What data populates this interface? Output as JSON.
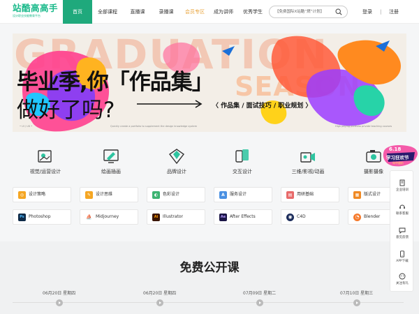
{
  "header": {
    "logo_title": "站酷高高手",
    "logo_subtitle": "设计职业技能教育平台",
    "nav": [
      {
        "label": "首页",
        "active": true
      },
      {
        "label": "全部课程"
      },
      {
        "label": "直播课"
      },
      {
        "label": "录播课"
      },
      {
        "label": "会员专区",
        "vip": true
      },
      {
        "label": "成为讲师"
      },
      {
        "label": "优秀学生"
      }
    ],
    "search_value": "【免费国际X站酷“燃”计划】",
    "login_label": "登录",
    "separator": "|",
    "register_label": "注册",
    "accent_color": "#1fa97c"
  },
  "banner": {
    "bg_word_1": "GRADUATION",
    "bg_word_2": "SEASON",
    "headline_1": "毕业季,你「作品集」",
    "headline_2": "做好了吗?",
    "tagline": "〈 作品集 / 面试技巧 / 职业规划 〉",
    "tiny_left": "• UI / UX •",
    "tiny_mid": "Quickly create a portfolio to supplement the design knowledge system",
    "tiny_right": "High paying portfolio private teaching courses"
  },
  "categories": [
    {
      "label": "视觉/运营设计",
      "icon": "visual-design-icon"
    },
    {
      "label": "绘画插画",
      "icon": "illustration-icon"
    },
    {
      "label": "品牌设计",
      "icon": "brand-design-icon"
    },
    {
      "label": "交互设计",
      "icon": "interaction-design-icon"
    },
    {
      "label": "三维/影视/动画",
      "icon": "3d-animation-icon"
    },
    {
      "label": "摄影摄像",
      "icon": "camera-icon"
    }
  ],
  "tags_row1": [
    {
      "label": "设计策略",
      "icon": "strategy-icon",
      "color": "#f5a623",
      "glyph": "◎"
    },
    {
      "label": "设计思维",
      "icon": "thinking-icon",
      "color": "#f5a623",
      "glyph": "✎"
    },
    {
      "label": "色彩设计",
      "icon": "color-icon",
      "color": "#3cb371",
      "glyph": "◐"
    },
    {
      "label": "服务设计",
      "icon": "service-icon",
      "color": "#4a90e2",
      "glyph": "A"
    },
    {
      "label": "用研基础",
      "icon": "research-icon",
      "color": "#e86a6a",
      "glyph": "▤"
    },
    {
      "label": "版式设计",
      "icon": "layout-icon",
      "color": "#f08a24",
      "glyph": "▦"
    }
  ],
  "tags_row2": [
    {
      "label": "Photoshop",
      "icon": "photoshop-icon",
      "color": "#0e2a47",
      "glyph": "Ps"
    },
    {
      "label": "Midjourney",
      "icon": "midjourney-icon",
      "color": "#ffffff",
      "glyph": "⛵"
    },
    {
      "label": "Illustrator",
      "icon": "illustrator-icon",
      "color": "#3a1500",
      "glyph": "Ai"
    },
    {
      "label": "After Effects",
      "icon": "after-effects-icon",
      "color": "#1a1446",
      "glyph": "Ae"
    },
    {
      "label": "C4D",
      "icon": "c4d-icon",
      "color": "#1b2b5a",
      "glyph": "◉"
    },
    {
      "label": "Blender",
      "icon": "blender-icon",
      "color": "#f5792a",
      "glyph": "◔"
    }
  ],
  "free_section": {
    "title": "免费公开课",
    "dates": [
      "06月20日 星期四",
      "06月20日 星期四",
      "07月09日 星期二",
      "07月10日 星期三"
    ]
  },
  "side_panel": {
    "promo_top": "学习狂欢节",
    "promo_sub": "年中放价",
    "items": [
      {
        "label": "企业培训",
        "icon": "enterprise-training-icon"
      },
      {
        "label": "联系客服",
        "icon": "customer-service-icon"
      },
      {
        "label": "意见反馈",
        "icon": "feedback-icon"
      },
      {
        "label": "APP下载",
        "icon": "app-download-icon"
      },
      {
        "label": "关注有礼",
        "icon": "follow-gift-icon"
      }
    ]
  }
}
